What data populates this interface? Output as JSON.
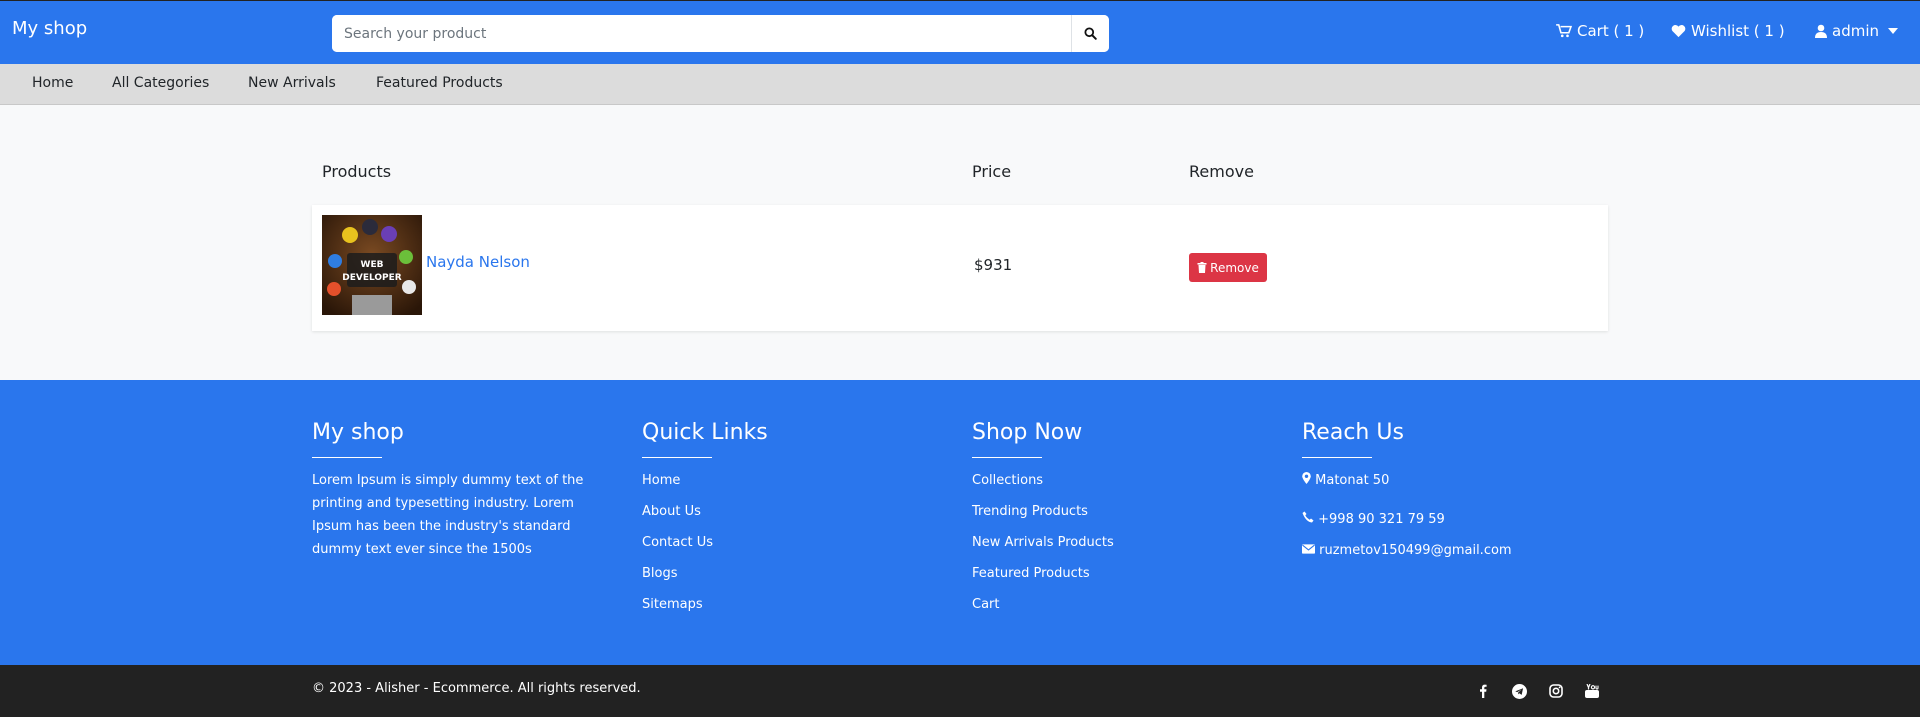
{
  "header": {
    "brand": "My shop",
    "search_placeholder": "Search your product",
    "cart_label": "Cart ( 1 )",
    "wishlist_label": "Wishlist ( 1 )",
    "user_label": "admin"
  },
  "nav": {
    "items": [
      "Home",
      "All Categories",
      "New Arrivals",
      "Featured Products"
    ]
  },
  "table": {
    "headers": {
      "products": "Products",
      "price": "Price",
      "remove": "Remove"
    },
    "rows": [
      {
        "name": "Nayda Nelson",
        "price": "$931",
        "remove_label": "Remove",
        "thumb_text": "WEB DEVELOPER"
      }
    ]
  },
  "footer": {
    "about": {
      "title": "My shop",
      "text": "Lorem Ipsum is simply dummy text of the printing and typesetting industry. Lorem Ipsum has been the industry's standard dummy text ever since the 1500s"
    },
    "quick_links": {
      "title": "Quick Links",
      "items": [
        "Home",
        "About Us",
        "Contact Us",
        "Blogs",
        "Sitemaps"
      ]
    },
    "shop_now": {
      "title": "Shop Now",
      "items": [
        "Collections",
        "Trending Products",
        "New Arrivals Products",
        "Featured Products",
        "Cart"
      ]
    },
    "reach_us": {
      "title": "Reach Us",
      "address": "Matonat 50",
      "phone": "+998 90 321 79 59",
      "email": "ruzmetov150499@gmail.com"
    }
  },
  "bottom": {
    "copyright": "© 2023 - Alisher - Ecommerce. All rights reserved.",
    "social_icons": [
      "facebook-icon",
      "telegram-icon",
      "instagram-icon",
      "youtube-icon"
    ]
  },
  "colors": {
    "primary": "#2a76ed",
    "danger": "#dc3545",
    "dark": "#222222",
    "subnav": "#dcdcdc"
  }
}
